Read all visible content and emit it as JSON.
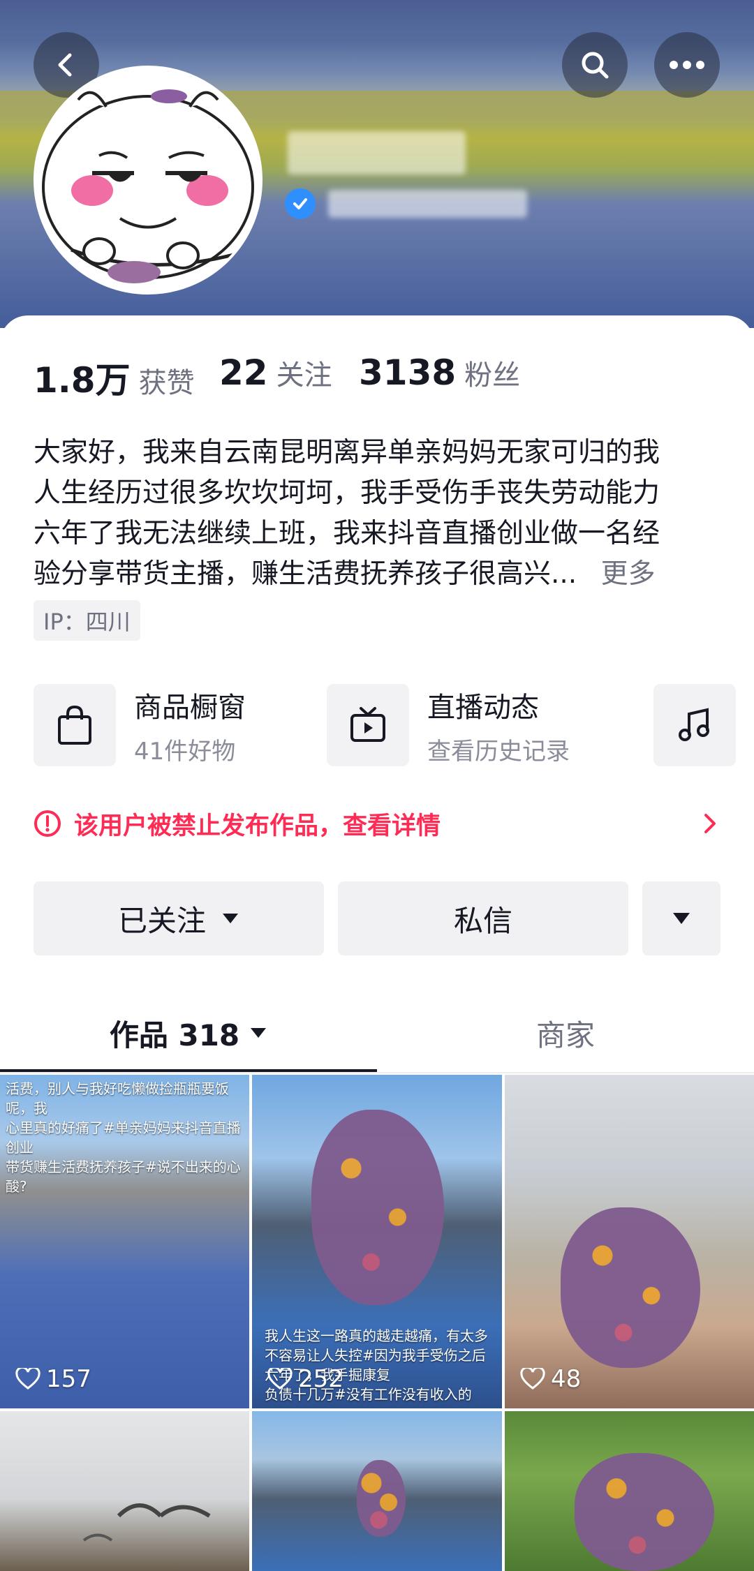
{
  "header": {
    "back_icon": "chevron-left-icon",
    "search_icon": "search-icon",
    "more_icon": "more-dots-icon",
    "verified_icon": "verified-check-icon"
  },
  "stats": [
    {
      "value": "1.8万",
      "label": "获赞"
    },
    {
      "value": "22",
      "label": "关注"
    },
    {
      "value": "3138",
      "label": "粉丝"
    }
  ],
  "bio": {
    "lines": [
      "大家好，我来自云南昆明离异单亲妈妈无家可归的我",
      "人生经历过很多坎坎坷坷，我手受伤手丧失劳动能力",
      "六年了我无法继续上班，我来抖音直播创业做一名经",
      "验分享带货主播，赚生活费抚养孩子很高兴..."
    ],
    "more_label": "更多",
    "ip": "IP：四川"
  },
  "features": [
    {
      "title": "商品橱窗",
      "subtitle": "41件好物",
      "icon": "shopping-bag-icon"
    },
    {
      "title": "直播动态",
      "subtitle": "查看历史记录",
      "icon": "live-tv-icon"
    },
    {
      "icon": "music-note-icon"
    }
  ],
  "warning": {
    "text": "该用户被禁止发布作品，查看详情",
    "icon": "alert-circle-icon"
  },
  "actions": {
    "follow": "已关注",
    "message": "私信"
  },
  "tabs": [
    {
      "label": "作品 318",
      "active": true
    },
    {
      "label": "商家",
      "active": false
    }
  ],
  "videos": [
    {
      "likes": "157",
      "caption": "活费，别人与我好吃懒做捡瓶瓶要饭呢，我\n心里真的好痛了#单亲妈妈来抖音直播创业\n带货赚生活费抚养孩子#说不出来的心酸?"
    },
    {
      "likes": "252",
      "caption": "我人生这一路真的越走越痛，有太多\n不容易让人失控#因为我手受伤之后\n六年了，我手掘康复\n负债十几万#没有工作没有收入的"
    },
    {
      "likes": "48",
      "caption": ""
    },
    {
      "likes": "",
      "caption": ""
    },
    {
      "likes": "",
      "caption": ""
    },
    {
      "likes": "",
      "caption": ""
    }
  ],
  "colors": {
    "accent_red": "#fe2c55",
    "text_primary": "#161823",
    "text_secondary": "#6e7180"
  }
}
